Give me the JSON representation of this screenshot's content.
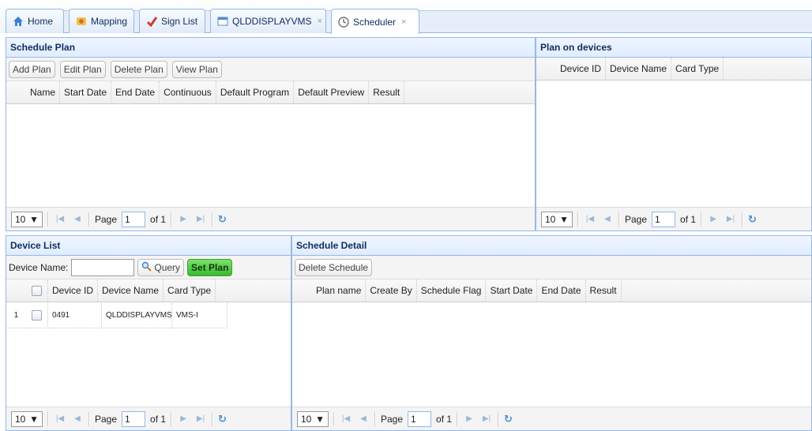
{
  "tabs": [
    {
      "label": "Home",
      "icon": "home-icon",
      "closable": false
    },
    {
      "label": "Mapping",
      "icon": "mapping-icon",
      "closable": false
    },
    {
      "label": "Sign List",
      "icon": "sign-list-icon",
      "closable": false
    },
    {
      "label": "QLDDISPLAYVMS",
      "icon": "display-icon",
      "closable": true
    },
    {
      "label": "Scheduler",
      "icon": "scheduler-icon",
      "closable": true,
      "active": true
    }
  ],
  "close_glyph": "×",
  "schedule_plan": {
    "title": "Schedule Plan",
    "buttons": {
      "add": "Add Plan",
      "edit": "Edit Plan",
      "delete": "Delete Plan",
      "view": "View Plan"
    },
    "columns": [
      "Name",
      "Start Date",
      "End Date",
      "Continuous",
      "Default Program",
      "Default Preview",
      "Result"
    ]
  },
  "plan_on_devices": {
    "title": "Plan on devices",
    "columns": [
      "Device ID",
      "Device Name",
      "Card Type"
    ]
  },
  "device_list": {
    "title": "Device List",
    "search_label": "Device Name:",
    "search_value": "",
    "query_button": "Query",
    "set_plan_button": "Set Plan",
    "columns": [
      "Device ID",
      "Device Name",
      "Card Type"
    ],
    "rows": [
      {
        "num": "1",
        "device_id": "0491",
        "device_name": "QLDDISPLAYVMS",
        "card_type": "VMS-I"
      }
    ]
  },
  "schedule_detail": {
    "title": "Schedule Detail",
    "delete_button": "Delete Schedule",
    "columns": [
      "Plan name",
      "Create By",
      "Schedule Flag",
      "Start Date",
      "End Date",
      "Result"
    ]
  },
  "pager": {
    "page_size": "10",
    "page_label": "Page",
    "page": "1",
    "of_label": "of 1"
  },
  "colors": {
    "border": "#95b8e7",
    "header_bg": "#e0ecff",
    "set_plan_green": "#3cb832"
  }
}
